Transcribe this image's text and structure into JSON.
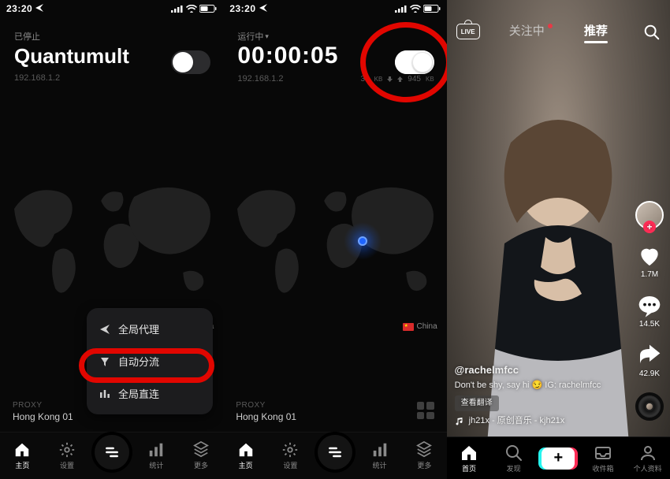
{
  "statusbar": {
    "time": "23:20"
  },
  "phone1": {
    "status_label": "已停止",
    "title": "Quantumult",
    "ip": "192.168.1.2",
    "country": "China",
    "proxy_label": "PROXY",
    "proxy_value": "Hong Kong 01",
    "toggle_on": false,
    "menu": {
      "opt1": "全局代理",
      "opt2": "自动分流",
      "opt3": "全局直连"
    }
  },
  "phone2": {
    "status_label": "运行中",
    "timer": "00:00:05",
    "ip": "192.168.1.2",
    "down_value": "30",
    "down_unit": "KB",
    "up_value": "945",
    "up_unit": "KB",
    "country": "China",
    "proxy_label": "PROXY",
    "proxy_value": "Hong Kong 01",
    "toggle_on": true
  },
  "tabs": {
    "home": "主页",
    "settings": "设置",
    "stats": "统计",
    "more": "更多"
  },
  "tiktok": {
    "top_follow": "关注中",
    "top_recommend": "推荐",
    "live": "LIVE",
    "username": "@rachelmfcc",
    "caption": "Don't be shy, say hi 😏 IG: rachelmfcc",
    "translate": "查看翻译",
    "music": "jh21x - 原创音乐 - kjh21x",
    "likes": "1.7M",
    "comments": "14.5K",
    "shares": "42.9K",
    "tab_home": "首页",
    "tab_discover": "发现",
    "tab_inbox": "收件箱",
    "tab_profile": "个人资料"
  }
}
